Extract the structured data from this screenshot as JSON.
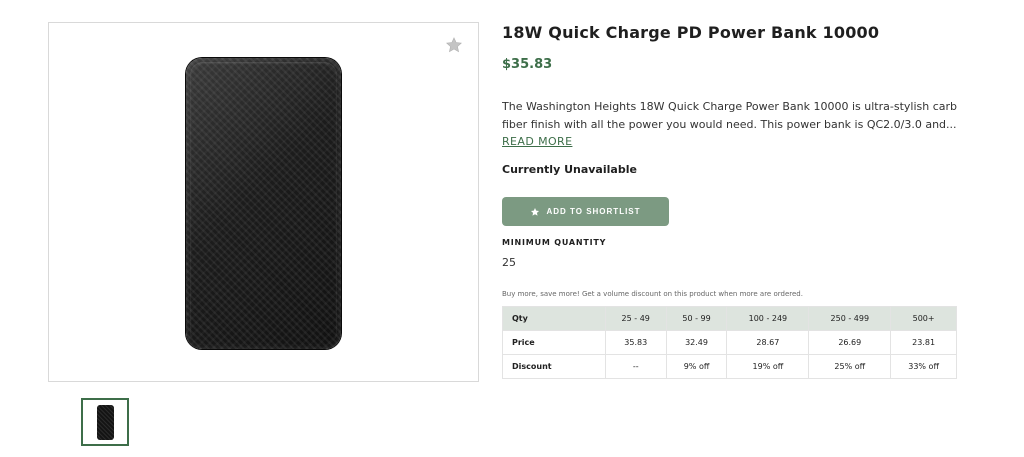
{
  "product": {
    "title": "18W Quick Charge PD Power Bank 10000",
    "price": "$35.83",
    "description_line1": "The Washington Heights 18W Quick Charge Power Bank 10000 is ultra-stylish carbon",
    "description_line2": "fiber finish with all the power you would need. This power bank is QC2.0/3.0 and...",
    "read_more": "READ MORE",
    "availability": "Currently Unavailable"
  },
  "actions": {
    "shortlist_label": "ADD TO SHORTLIST"
  },
  "minimum_quantity": {
    "label": "MINIMUM QUANTITY",
    "value": "25"
  },
  "volume_note": "Buy more, save more! Get a volume discount on this product when more are ordered.",
  "pricing_table": {
    "header": [
      "Qty",
      "25 - 49",
      "50 - 99",
      "100 - 249",
      "250 - 499",
      "500+"
    ],
    "rows": [
      [
        "Price",
        "35.83",
        "32.49",
        "28.67",
        "26.69",
        "23.81"
      ],
      [
        "Discount",
        "--",
        "9% off",
        "19% off",
        "25% off",
        "33% off"
      ]
    ]
  },
  "icons": {
    "favorite": "star-icon",
    "shortlist": "star-icon"
  },
  "colors": {
    "accent": "#3d6e49",
    "button": "#7c9a82",
    "table_header": "#dde4de"
  }
}
